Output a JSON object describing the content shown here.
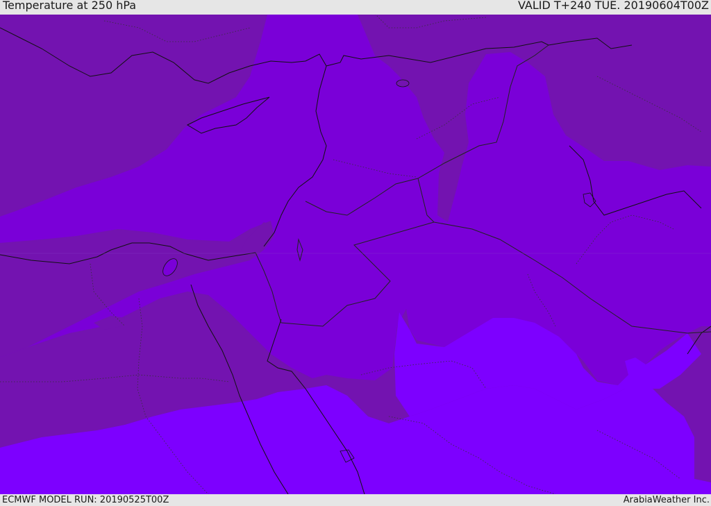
{
  "header": {
    "title": "Temperature at 250 hPa",
    "valid": "VALID T+240 TUE. 20190604T00Z"
  },
  "footer": {
    "model_run": "ECMWF MODEL RUN: 20190525T00Z",
    "credit": "ArabiaWeather Inc."
  },
  "map": {
    "colors": {
      "warm_band": "#7313b0",
      "mid_band": "#7a00d8",
      "cold_band": "#7d00ff",
      "coastline": "#111111",
      "border": "#222222"
    }
  }
}
